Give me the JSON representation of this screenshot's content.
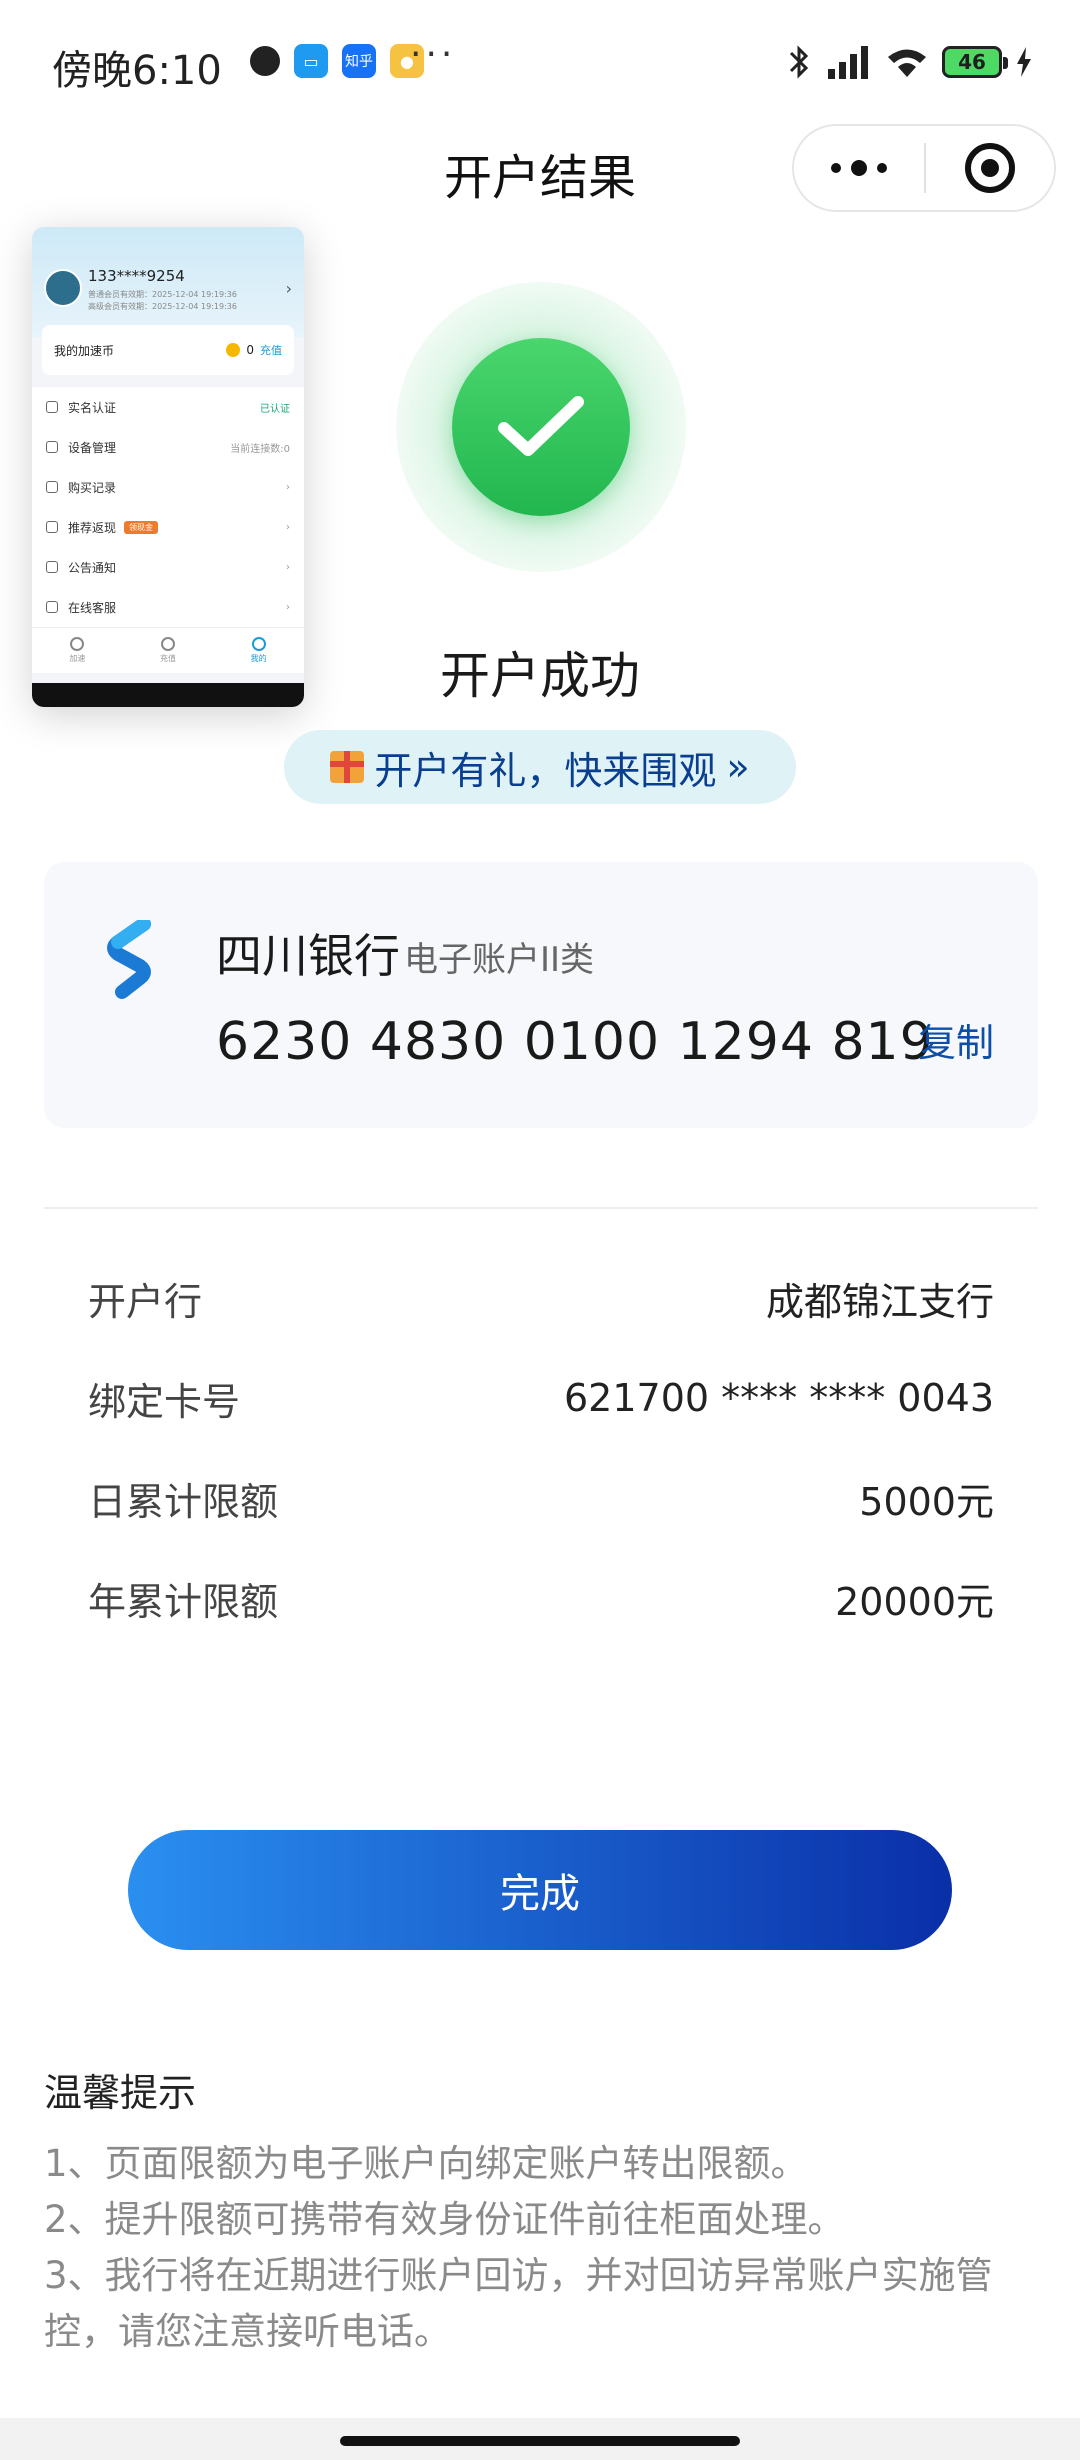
{
  "status_bar": {
    "time": "傍晚6:10",
    "apps": [
      "qq-icon",
      "message-icon",
      "zhihu-icon",
      "weibo-icon"
    ],
    "zhihu_label": "知乎",
    "more": "···",
    "battery": "46"
  },
  "nav": {
    "title": "开户结果"
  },
  "thumbnail": {
    "phone": "133****9254",
    "line1": "普通会员有效期：2025-12-04 19:19:36",
    "line2": "高级会员有效期：2025-12-04 19:19:36",
    "coin_label": "我的加速币",
    "coin_value": "0",
    "recharge": "充值",
    "items": [
      {
        "label": "实名认证",
        "right": "已认证"
      },
      {
        "label": "设备管理",
        "right": "当前连接数:0"
      },
      {
        "label": "购买记录",
        "right": ""
      },
      {
        "label": "推荐返现",
        "right": "",
        "tag": "领现金"
      },
      {
        "label": "公告通知",
        "right": ""
      },
      {
        "label": "在线客服",
        "right": ""
      }
    ],
    "tabs": [
      "加速",
      "充值",
      "我的"
    ]
  },
  "result": {
    "title": "开户成功",
    "promo": "开户有礼，快来围观",
    "promo_arrow": "»"
  },
  "account": {
    "bank_name": "四川银行",
    "account_type": "电子账户II类",
    "account_number": "6230 4830 0100 1294 819",
    "copy_label": "复制"
  },
  "details": [
    {
      "label": "开户行",
      "value": "成都锦江支行"
    },
    {
      "label": "绑定卡号",
      "value": "621700 **** **** 0043"
    },
    {
      "label": "日累计限额",
      "value": "5000元"
    },
    {
      "label": "年累计限额",
      "value": "20000元"
    }
  ],
  "done_label": "完成",
  "tips": {
    "title": "温馨提示",
    "items": [
      "1、页面限额为电子账户向绑定账户转出限额。",
      "2、提升限额可携带有效身份证件前往柜面处理。",
      "3、我行将在近期进行账户回访，并对回访异常账户实施管控，请您注意接听电话。"
    ]
  },
  "colors": {
    "primary_blue": "#0d4ea8",
    "success_green": "#2fc15a",
    "button_gradient_start": "#2a8ff0",
    "button_gradient_end": "#0a2fa8"
  }
}
